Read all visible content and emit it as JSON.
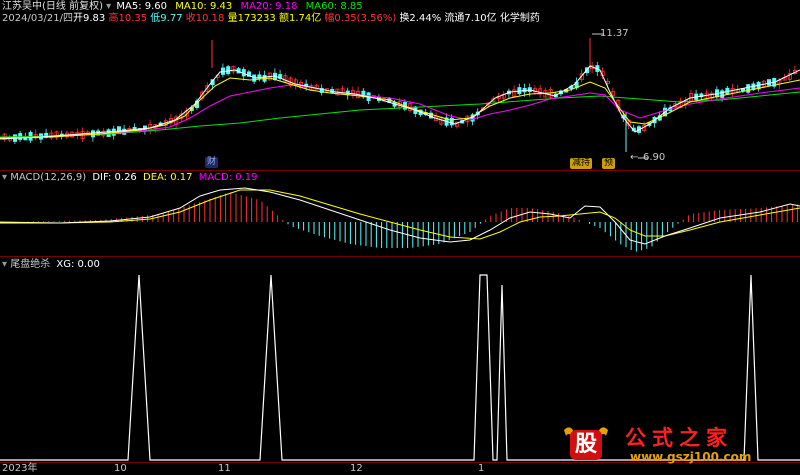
{
  "header": {
    "stock_name": "江苏吴中(日线 前复权)",
    "ma5": "MA5: 9.60",
    "ma10": "MA10: 9.43",
    "ma20": "MA20: 9.18",
    "ma60": "MA60: 8.85",
    "date": "2024/03/21/四",
    "open": "开9.83",
    "high": "高10.35",
    "low": "低9.77",
    "close": "收10.18",
    "volume": "量173233",
    "amount": "额1.74亿",
    "change": "幅0.35(3.56%)",
    "turnover": "换2.44%",
    "float_cap": "流通7.10亿",
    "sector": "化学制药"
  },
  "price_panel": {
    "high_marker": "11.37",
    "low_marker": "6.90",
    "badge_cai": "财",
    "badge_zhuanyi": "减持",
    "badge_yu": "预"
  },
  "macd_panel": {
    "title": "MACD(12,26,9)",
    "dif": "DIF: 0.26",
    "dea": "DEA: 0.17",
    "macd": "MACD: 0.19"
  },
  "signal_panel": {
    "title": "尾盘绝杀",
    "xg": "XG: 0.00"
  },
  "axis": {
    "labels": [
      "2023年",
      "10",
      "11",
      "12",
      "1"
    ]
  },
  "watermark": {
    "logo_char": "股",
    "brand": "公式之家",
    "url": "www.gszj100.com"
  },
  "colors": {
    "up": "#ff3232",
    "down": "#54fcfc",
    "ma5": "#ffffff",
    "ma10": "#ffff00",
    "ma20": "#ff00ff",
    "ma60": "#00e600",
    "divider": "#7a0000"
  }
}
